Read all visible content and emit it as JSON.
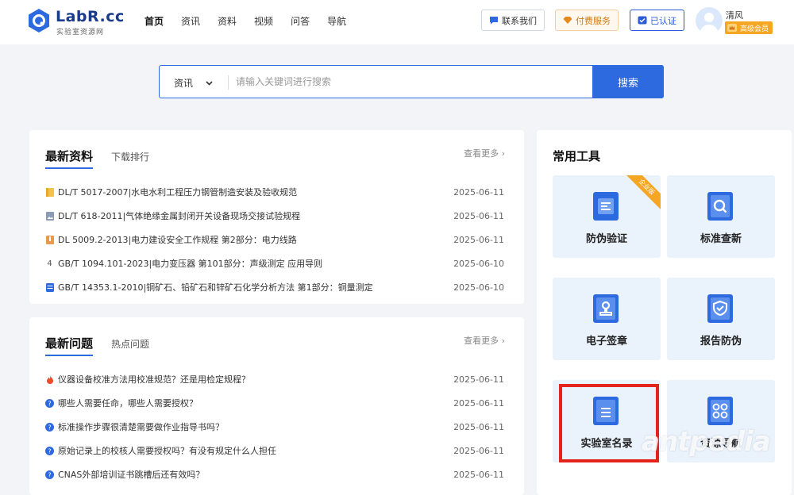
{
  "brand": {
    "name": "LabR.cc",
    "subtitle": "实验室资源网"
  },
  "nav": [
    {
      "label": "首页",
      "active": true
    },
    {
      "label": "资讯"
    },
    {
      "label": "资料"
    },
    {
      "label": "视频"
    },
    {
      "label": "问答"
    },
    {
      "label": "导航"
    }
  ],
  "header": {
    "contact": "联系我们",
    "paid": "付费服务",
    "verified": "已认证",
    "user_name": "清风",
    "vip_badge": "高级会员"
  },
  "search": {
    "category": "资讯",
    "placeholder": "请输入关键词进行搜索",
    "button": "搜索"
  },
  "latest_docs": {
    "title": "最新资料",
    "tab": "下载排行",
    "more": "查看更多",
    "items": [
      {
        "icon": "folder-icon",
        "text": "DL/T 5017-2007|水电水利工程压力钢管制造安装及验收规范",
        "date": "2025-06-11"
      },
      {
        "icon": "image-icon",
        "text": "DL/T 618-2011|气体绝缘金属封闭开关设备现场交接试验规程",
        "date": "2025-06-11"
      },
      {
        "icon": "archive-icon",
        "text": "DL 5009.2-2013|电力建设安全工作规程 第2部分：电力线路",
        "date": "2025-06-11"
      },
      {
        "icon": "number-four-icon",
        "text": "GB/T 1094.101-2023|电力变压器 第101部分：声级测定 应用导则",
        "date": "2025-06-10"
      },
      {
        "icon": "database-icon",
        "text": "GB/T 14353.1-2010|铜矿石、铅矿石和锌矿石化学分析方法 第1部分：铜量测定",
        "date": "2025-06-10"
      }
    ]
  },
  "latest_questions": {
    "title": "最新问题",
    "tab": "热点问题",
    "more": "查看更多",
    "items": [
      {
        "icon": "flame-icon",
        "text": "仪器设备校准方法用校准规范？还是用检定规程？",
        "date": "2025-06-11"
      },
      {
        "icon": "question-icon",
        "text": "哪些人需要任命，哪些人需要授权？",
        "date": "2025-06-11"
      },
      {
        "icon": "question-icon",
        "text": "标准操作步骤很清楚需要做作业指导书吗？",
        "date": "2025-06-11"
      },
      {
        "icon": "question-icon",
        "text": "原始记录上的校核人需要授权吗？有没有规定什么人担任",
        "date": "2025-06-11"
      },
      {
        "icon": "question-icon",
        "text": "CNAS外部培训证书跳槽后还有效吗？",
        "date": "2025-06-11"
      }
    ]
  },
  "tools": {
    "title": "常用工具",
    "items": [
      {
        "label": "防伪验证",
        "icon": "anti-counterfeit-icon",
        "ribbon": "企业版"
      },
      {
        "label": "标准查新",
        "icon": "standard-search-icon"
      },
      {
        "label": "电子签章",
        "icon": "e-seal-icon"
      },
      {
        "label": "报告防伪",
        "icon": "report-shield-icon"
      },
      {
        "label": "实验室名录",
        "icon": "lab-directory-icon",
        "highlighted": true
      },
      {
        "label": "资源导航",
        "icon": "resource-grid-icon"
      }
    ]
  },
  "watermark": "antpedia",
  "colors": {
    "primary": "#2d6ae0",
    "highlight": "#e4231c",
    "vip": "#f5a623"
  }
}
